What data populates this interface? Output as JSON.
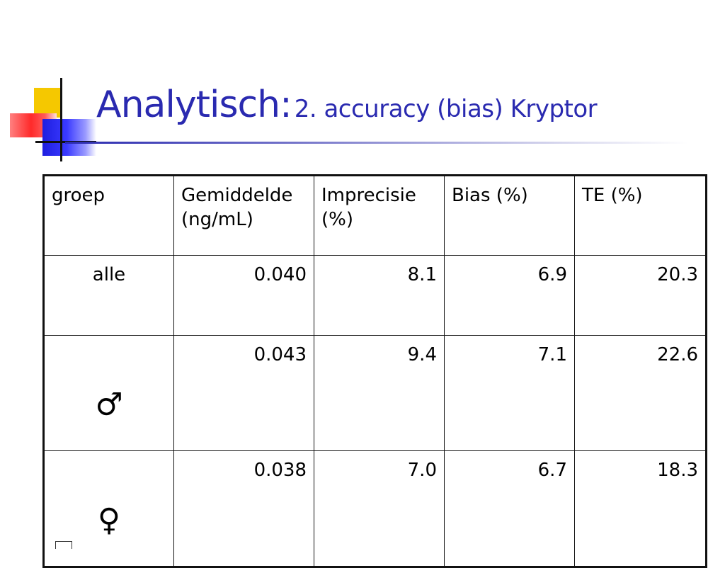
{
  "title": {
    "main": "Analytisch:",
    "sub": "2. accuracy (bias) Kryptor"
  },
  "table": {
    "headers": [
      "groep",
      "Gemiddelde\n(ng/mL)",
      "Imprecisie\n(%)",
      "Bias (%)",
      "TE (%)"
    ],
    "rows": [
      {
        "group": "alle",
        "values": [
          "0.040",
          "8.1",
          "6.9",
          "20.3"
        ]
      },
      {
        "group": "♂",
        "values": [
          "0.043",
          "9.4",
          "7.1",
          "22.6"
        ]
      },
      {
        "group": "♀",
        "values": [
          "0.038",
          "7.0",
          "6.7",
          "18.3"
        ]
      }
    ]
  },
  "colors": {
    "title": "#2a2ab0",
    "logo_yellow": "#f5c800",
    "logo_red": "#ff2a2a",
    "logo_blue": "#2a2aff"
  }
}
